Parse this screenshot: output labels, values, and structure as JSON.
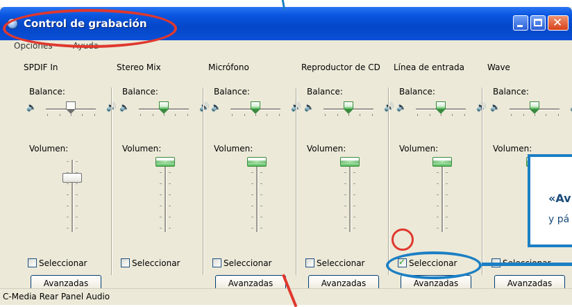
{
  "window": {
    "title": "Control de grabación",
    "title_color": "#ffffff",
    "titlebar_color": "#0a55e0"
  },
  "menu": {
    "opciones": "Opciones",
    "ayuda": "Ayuda"
  },
  "labels": {
    "balance": "Balance:",
    "volumen": "Volumen:",
    "seleccionar": "Seleccionar",
    "avanzadas": "Avanzadas"
  },
  "channels": [
    {
      "name": "SPDIF In",
      "selected": false,
      "balance_thumb": "white",
      "volume_thumb": "white",
      "volume_level": 0.75
    },
    {
      "name": "Stereo Mix",
      "selected": false,
      "balance_thumb": "green",
      "volume_thumb": "green",
      "volume_level": 1.0
    },
    {
      "name": "Micrófono",
      "selected": false,
      "balance_thumb": "green",
      "volume_thumb": "green",
      "volume_level": 1.0
    },
    {
      "name": "Reproductor de CD",
      "selected": false,
      "balance_thumb": "green",
      "volume_thumb": "green",
      "volume_level": 1.0
    },
    {
      "name": "Línea de entrada",
      "selected": true,
      "balance_thumb": "green",
      "volume_thumb": "green",
      "volume_level": 1.0
    },
    {
      "name": "Wave",
      "selected": false,
      "balance_thumb": "green",
      "volume_thumb": "green",
      "volume_level": 1.0
    }
  ],
  "status": {
    "text": "C-Media Rear Panel Audio"
  },
  "callout": {
    "title": "«Av",
    "subtitle": "y pá"
  },
  "annotation_colors": {
    "red": "#e0382e",
    "blue": "#1b7fc4"
  },
  "icons": {
    "app": "microphone-globe-icon",
    "speaker_left": "speaker-left-icon",
    "speaker_right": "speaker-right-icon"
  }
}
